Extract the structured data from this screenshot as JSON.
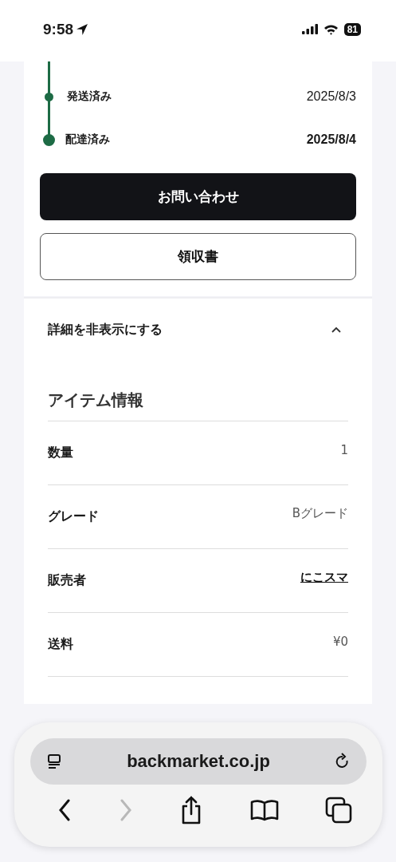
{
  "status_bar": {
    "time": "9:58",
    "battery": "81"
  },
  "timeline": [
    {
      "label": "発送済み",
      "date": "2025/8/3",
      "current": false
    },
    {
      "label": "配達済み",
      "date": "2025/8/4",
      "current": true
    }
  ],
  "buttons": [
    {
      "label": "お問い合わせ",
      "kind": "primary"
    },
    {
      "label": "領収書",
      "kind": "secondary"
    }
  ],
  "details_toggle": {
    "label": "詳細を非表示にする",
    "expanded": true
  },
  "item_info": {
    "title": "アイテム情報",
    "rows": [
      {
        "label": "数量",
        "value": "1",
        "kind": "text"
      },
      {
        "label": "グレード",
        "value": "Bグレード",
        "kind": "text"
      },
      {
        "label": "販売者",
        "value": "にこスマ",
        "kind": "link"
      },
      {
        "label": "送料",
        "value": "¥0",
        "kind": "text"
      }
    ]
  },
  "browser": {
    "url": "backmarket.co.jp",
    "forward_disabled": true
  }
}
